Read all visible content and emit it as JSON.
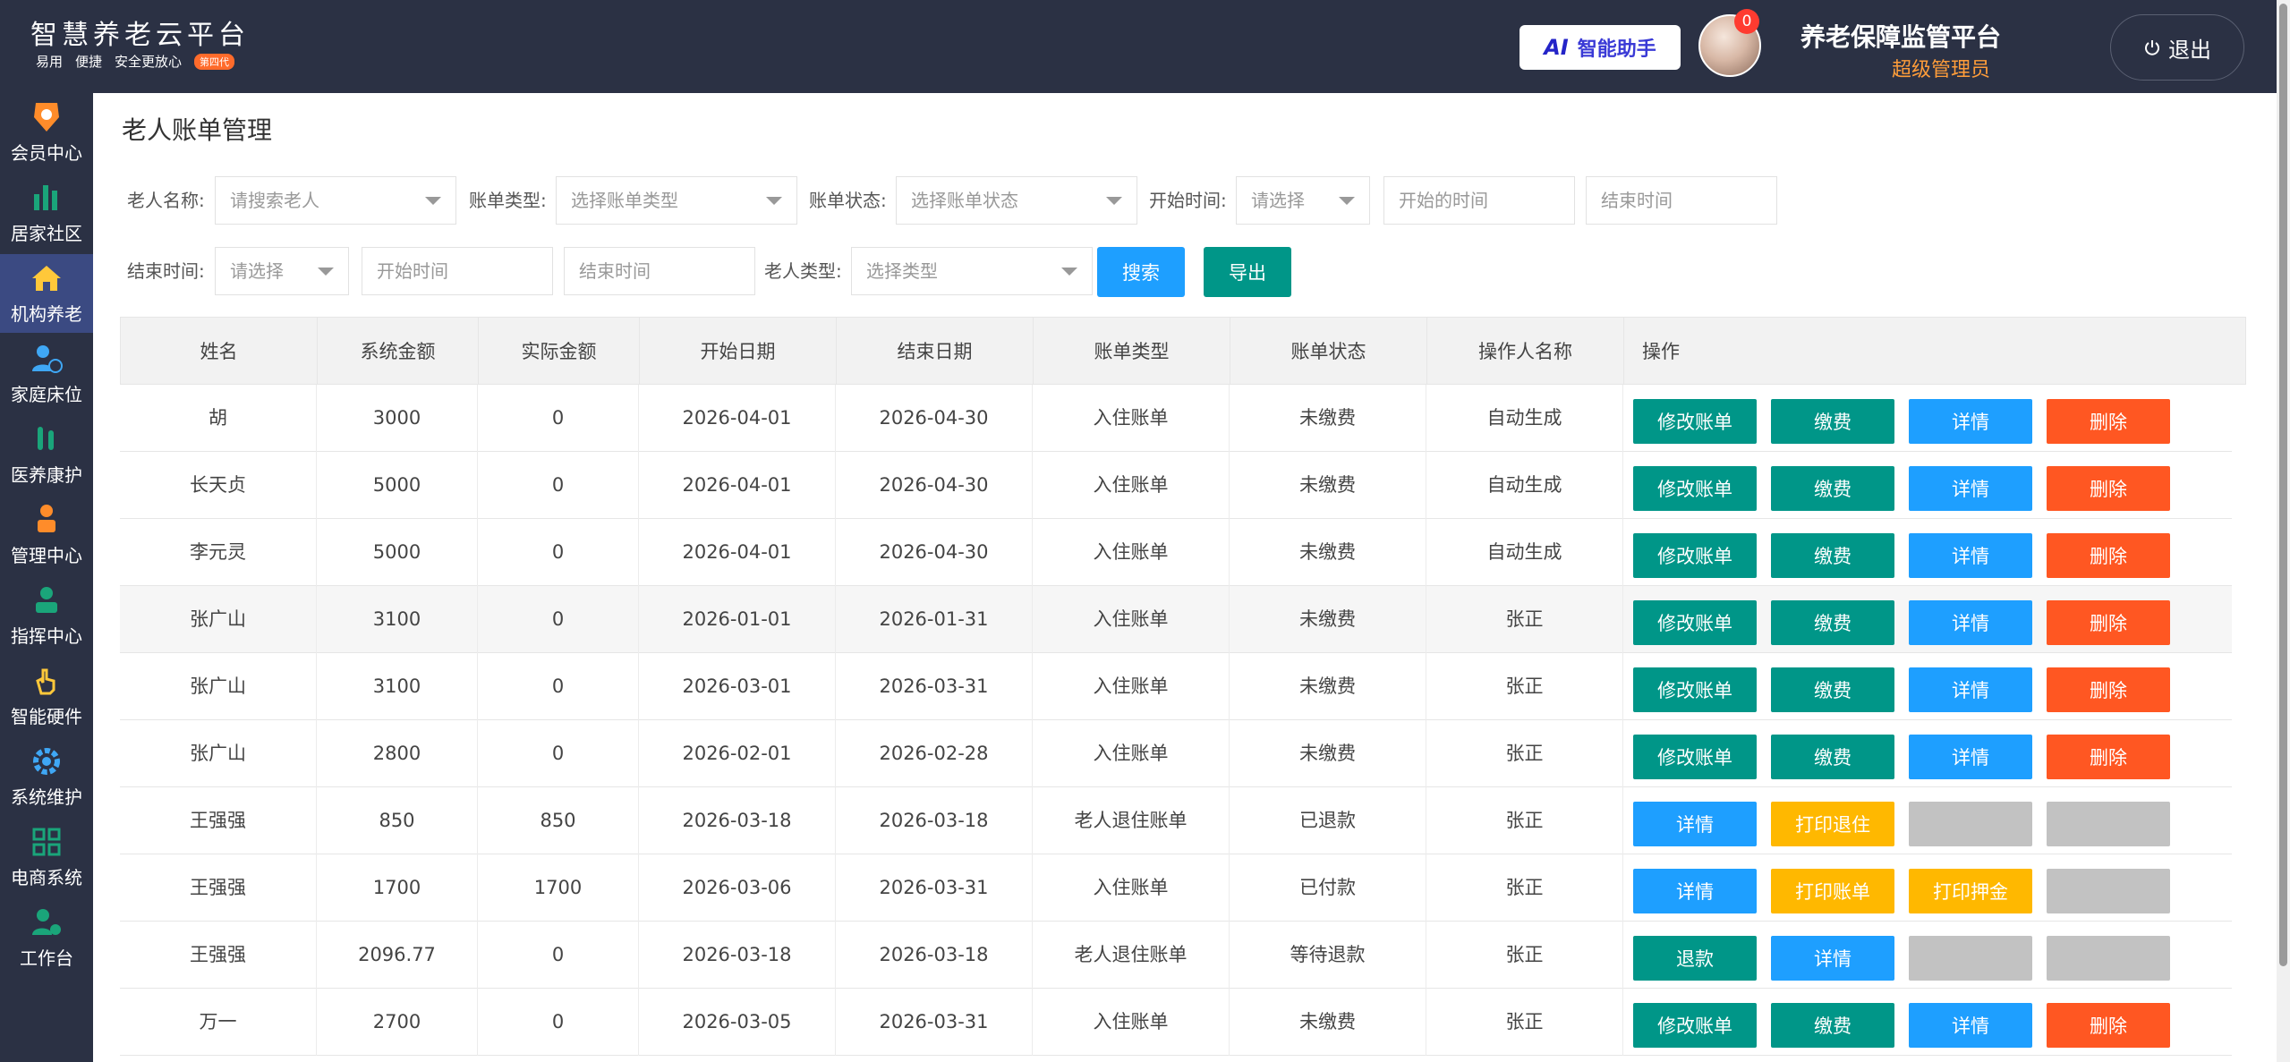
{
  "header": {
    "title": "智慧养老云平台",
    "sub": [
      "易用",
      "便捷",
      "安全更放心"
    ],
    "tag": "第四代",
    "ai_label": "智能助手",
    "ai_mark": "AI",
    "badge": "0",
    "platform": "养老保障监管平台",
    "role": "超级管理员",
    "logout": "退出"
  },
  "sidebar": {
    "items": [
      {
        "label": "会员中心",
        "icon": "member-icon"
      },
      {
        "label": "居家社区",
        "icon": "chart-icon"
      },
      {
        "label": "机构养老",
        "icon": "home-icon"
      },
      {
        "label": "家庭床位",
        "icon": "bed-icon"
      },
      {
        "label": "医养康护",
        "icon": "medical-icon"
      },
      {
        "label": "管理中心",
        "icon": "manage-icon"
      },
      {
        "label": "指挥中心",
        "icon": "command-icon"
      },
      {
        "label": "智能硬件",
        "icon": "hand-icon"
      },
      {
        "label": "系统维护",
        "icon": "gear-icon"
      },
      {
        "label": "电商系统",
        "icon": "grid-icon"
      },
      {
        "label": "工作台",
        "icon": "workbench-icon"
      }
    ],
    "active_index": 2
  },
  "page": {
    "title": "老人账单管理"
  },
  "filters": {
    "elder_name_label": "老人名称:",
    "elder_name_placeholder": "请搜索老人",
    "bill_type_label": "账单类型:",
    "bill_type_placeholder": "选择账单类型",
    "bill_status_label": "账单状态:",
    "bill_status_placeholder": "选择账单状态",
    "start_time_label": "开始时间:",
    "start_time_select": "请选择",
    "start_from_placeholder": "开始的时间",
    "start_to_placeholder": "结束时间",
    "end_time_label": "结束时间:",
    "end_time_select": "请选择",
    "end_from_placeholder": "开始时间",
    "end_to_placeholder": "结束时间",
    "elder_type_label": "老人类型:",
    "elder_type_placeholder": "选择类型",
    "search": "搜索",
    "export": "导出"
  },
  "table": {
    "headers": [
      "姓名",
      "系统金额",
      "实际金额",
      "开始日期",
      "结束日期",
      "账单类型",
      "账单状态",
      "操作人名称",
      "操作"
    ],
    "rows": [
      {
        "name": "胡",
        "sys": "3000",
        "actual": "0",
        "start": "2026-04-01",
        "end": "2026-04-30",
        "type": "入住账单",
        "status": "未缴费",
        "operator": "自动生成",
        "ops": [
          {
            "label": "修改账单",
            "color": "#009688"
          },
          {
            "label": "缴费",
            "color": "#009688"
          },
          {
            "label": "详情",
            "color": "#1e9fff"
          },
          {
            "label": "删除",
            "color": "#ff5722"
          }
        ]
      },
      {
        "name": "长天贞",
        "sys": "5000",
        "actual": "0",
        "start": "2026-04-01",
        "end": "2026-04-30",
        "type": "入住账单",
        "status": "未缴费",
        "operator": "自动生成",
        "ops": [
          {
            "label": "修改账单",
            "color": "#009688"
          },
          {
            "label": "缴费",
            "color": "#009688"
          },
          {
            "label": "详情",
            "color": "#1e9fff"
          },
          {
            "label": "删除",
            "color": "#ff5722"
          }
        ]
      },
      {
        "name": "李元灵",
        "sys": "5000",
        "actual": "0",
        "start": "2026-04-01",
        "end": "2026-04-30",
        "type": "入住账单",
        "status": "未缴费",
        "operator": "自动生成",
        "ops": [
          {
            "label": "修改账单",
            "color": "#009688"
          },
          {
            "label": "缴费",
            "color": "#009688"
          },
          {
            "label": "详情",
            "color": "#1e9fff"
          },
          {
            "label": "删除",
            "color": "#ff5722"
          }
        ]
      },
      {
        "name": "张广山",
        "sys": "3100",
        "actual": "0",
        "start": "2026-01-01",
        "end": "2026-01-31",
        "type": "入住账单",
        "status": "未缴费",
        "operator": "张正",
        "ops": [
          {
            "label": "修改账单",
            "color": "#009688"
          },
          {
            "label": "缴费",
            "color": "#009688"
          },
          {
            "label": "详情",
            "color": "#1e9fff"
          },
          {
            "label": "删除",
            "color": "#ff5722"
          }
        ]
      },
      {
        "name": "张广山",
        "sys": "3100",
        "actual": "0",
        "start": "2026-03-01",
        "end": "2026-03-31",
        "type": "入住账单",
        "status": "未缴费",
        "operator": "张正",
        "ops": [
          {
            "label": "修改账单",
            "color": "#009688"
          },
          {
            "label": "缴费",
            "color": "#009688"
          },
          {
            "label": "详情",
            "color": "#1e9fff"
          },
          {
            "label": "删除",
            "color": "#ff5722"
          }
        ]
      },
      {
        "name": "张广山",
        "sys": "2800",
        "actual": "0",
        "start": "2026-02-01",
        "end": "2026-02-28",
        "type": "入住账单",
        "status": "未缴费",
        "operator": "张正",
        "ops": [
          {
            "label": "修改账单",
            "color": "#009688"
          },
          {
            "label": "缴费",
            "color": "#009688"
          },
          {
            "label": "详情",
            "color": "#1e9fff"
          },
          {
            "label": "删除",
            "color": "#ff5722"
          }
        ]
      },
      {
        "name": "王强强",
        "sys": "850",
        "actual": "850",
        "start": "2026-03-18",
        "end": "2026-03-18",
        "type": "老人退住账单",
        "status": "已退款",
        "operator": "张正",
        "ops": [
          {
            "label": "详情",
            "color": "#1e9fff"
          },
          {
            "label": "打印退住",
            "color": "#ffb800"
          },
          {
            "label": "",
            "color": "#c2c2c2"
          },
          {
            "label": "",
            "color": "#c2c2c2"
          }
        ]
      },
      {
        "name": "王强强",
        "sys": "1700",
        "actual": "1700",
        "start": "2026-03-06",
        "end": "2026-03-31",
        "type": "入住账单",
        "status": "已付款",
        "operator": "张正",
        "ops": [
          {
            "label": "详情",
            "color": "#1e9fff"
          },
          {
            "label": "打印账单",
            "color": "#ffb800"
          },
          {
            "label": "打印押金",
            "color": "#ffb800"
          },
          {
            "label": "",
            "color": "#c2c2c2"
          }
        ]
      },
      {
        "name": "王强强",
        "sys": "2096.77",
        "actual": "0",
        "start": "2026-03-18",
        "end": "2026-03-18",
        "type": "老人退住账单",
        "status": "等待退款",
        "operator": "张正",
        "ops": [
          {
            "label": "退款",
            "color": "#009688"
          },
          {
            "label": "详情",
            "color": "#1e9fff"
          },
          {
            "label": "",
            "color": "#c2c2c2"
          },
          {
            "label": "",
            "color": "#c2c2c2"
          }
        ]
      },
      {
        "name": "万一",
        "sys": "2700",
        "actual": "0",
        "start": "2026-03-05",
        "end": "2026-03-31",
        "type": "入住账单",
        "status": "未缴费",
        "operator": "张正",
        "ops": [
          {
            "label": "修改账单",
            "color": "#009688"
          },
          {
            "label": "缴费",
            "color": "#009688"
          },
          {
            "label": "详情",
            "color": "#1e9fff"
          },
          {
            "label": "删除",
            "color": "#ff5722"
          }
        ]
      }
    ]
  }
}
